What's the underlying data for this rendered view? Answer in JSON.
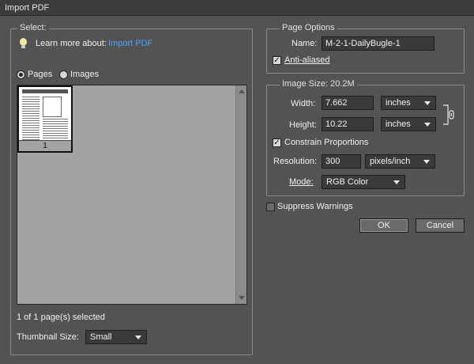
{
  "window": {
    "title": "Import PDF"
  },
  "select_group": {
    "legend": "Select:",
    "learn_more_prefix": "Learn more about:",
    "learn_more_link": "Import PDF",
    "radio_pages": "Pages",
    "radio_images": "Images",
    "selected_radio": "Pages",
    "thumbnail_page_number": "1",
    "status": "1 of 1 page(s) selected",
    "thumbnail_size_label": "Thumbnail Size:",
    "thumbnail_size_value": "Small"
  },
  "page_options": {
    "legend": "Page Options",
    "name_label": "Name:",
    "name_value": "M-2-1-DailyBugle-1",
    "anti_aliased_label": "Anti-aliased",
    "anti_aliased_checked": true
  },
  "image_size": {
    "legend": "Image Size: 20.2M",
    "width_label": "Width:",
    "width_value": "7.662",
    "width_unit": "inches",
    "height_label": "Height:",
    "height_value": "10.22",
    "height_unit": "inches",
    "constrain_label": "Constrain Proportions",
    "constrain_checked": true,
    "resolution_label": "Resolution:",
    "resolution_value": "300",
    "resolution_unit": "pixels/inch",
    "mode_label": "Mode:",
    "mode_value": "RGB Color"
  },
  "suppress_warnings": {
    "label": "Suppress Warnings",
    "checked": false
  },
  "buttons": {
    "ok": "OK",
    "cancel": "Cancel"
  }
}
